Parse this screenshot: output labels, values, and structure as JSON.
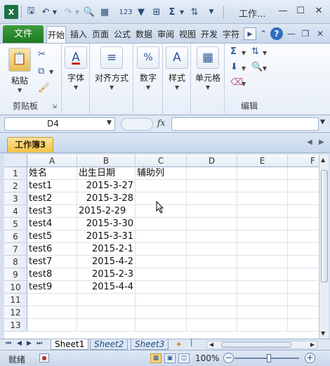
{
  "window": {
    "title": "工作...",
    "app_icon": "excel-icon"
  },
  "quick_access": {
    "save_icon": "save-icon",
    "undo_icon": "undo-icon",
    "redo_icon": "redo-icon"
  },
  "ribbon": {
    "file_tab": "文件",
    "tabs": [
      "开始",
      "插入",
      "页面",
      "公式",
      "数据",
      "审阅",
      "视图",
      "开发",
      "字符"
    ],
    "active_tab": "开始",
    "groups": {
      "clipboard": {
        "label": "剪贴板",
        "paste": "粘贴"
      },
      "font": {
        "label": "字体"
      },
      "alignment": {
        "label": "对齐方式"
      },
      "number": {
        "label": "数字"
      },
      "styles": {
        "label": "样式"
      },
      "cells": {
        "label": "单元格"
      },
      "editing": {
        "label": "编辑"
      }
    }
  },
  "formula_bar": {
    "name_box": "D4",
    "fx": "fx",
    "value": ""
  },
  "workbook": {
    "caption": "工作簿3"
  },
  "grid": {
    "columns": [
      "A",
      "B",
      "C",
      "D",
      "E",
      "F"
    ],
    "rows": [
      "1",
      "2",
      "3",
      "4",
      "5",
      "6",
      "7",
      "8",
      "9",
      "10",
      "11",
      "12",
      "13"
    ],
    "cells": [
      [
        "姓名",
        "出生日期",
        "辅助列"
      ],
      [
        "test1",
        "2015-3-27",
        ""
      ],
      [
        "test2",
        "2015-3-28",
        ""
      ],
      [
        "test3",
        "2015-2-29",
        ""
      ],
      [
        "test4",
        "2015-3-30",
        ""
      ],
      [
        "test5",
        "2015-3-31",
        ""
      ],
      [
        "test6",
        "2015-2-1",
        ""
      ],
      [
        "test7",
        "2015-4-2",
        ""
      ],
      [
        "test8",
        "2015-2-3",
        ""
      ],
      [
        "test9",
        "2015-4-4",
        ""
      ]
    ],
    "selected_cell": "D4"
  },
  "sheets": {
    "tabs": [
      "Sheet1",
      "Sheet2",
      "Sheet3"
    ],
    "active": "Sheet1"
  },
  "status": {
    "ready": "就绪",
    "zoom": "100%",
    "zoom_out": "−",
    "zoom_in": "+"
  },
  "colors": {
    "accent_green": "#1f7a1f",
    "workbook_tab": "#f3c247"
  }
}
